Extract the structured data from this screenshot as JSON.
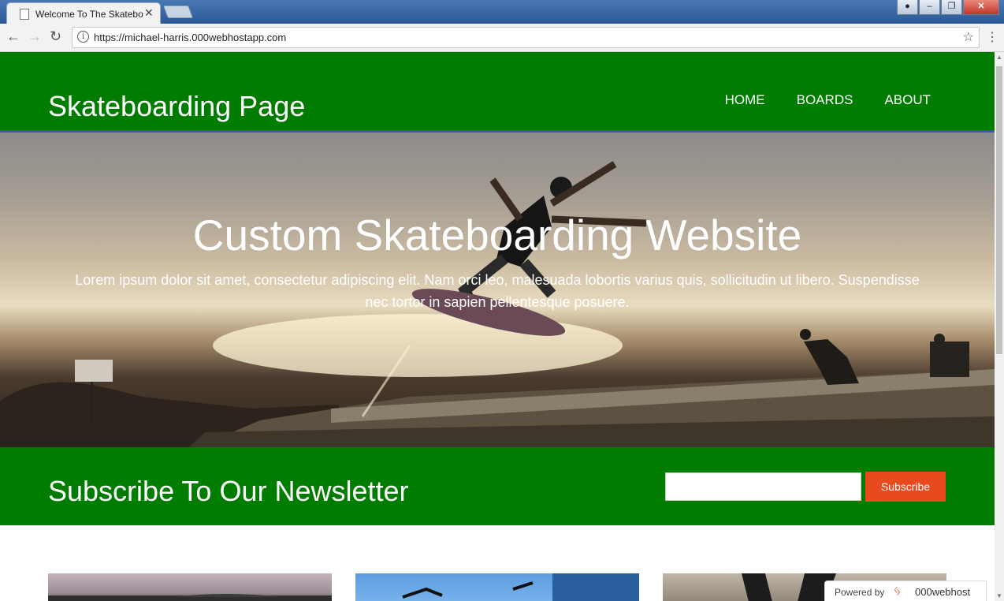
{
  "browser": {
    "tab_title": "Welcome To The Skatebo",
    "url": "https://michael-harris.000webhostapp.com"
  },
  "site": {
    "brand": "Skateboarding Page",
    "nav": [
      "HOME",
      "BOARDS",
      "ABOUT"
    ]
  },
  "hero": {
    "title": "Custom Skateboarding Website",
    "text": "Lorem ipsum dolor sit amet, consectetur adipiscing elit. Nam orci leo, malesuada lobortis varius quis, sollicitudin ut libero. Suspendisse nec tortor in sapien pellentesque posuere."
  },
  "newsletter": {
    "title": "Subscribe To Our Newsletter",
    "input_value": "",
    "button_label": "Subscribe"
  },
  "badge": {
    "label": "Powered by",
    "brand": "000webhost"
  },
  "colors": {
    "header_green": "#007d00",
    "accent_orange": "#e8491d",
    "border_blue": "#3b50c4"
  }
}
